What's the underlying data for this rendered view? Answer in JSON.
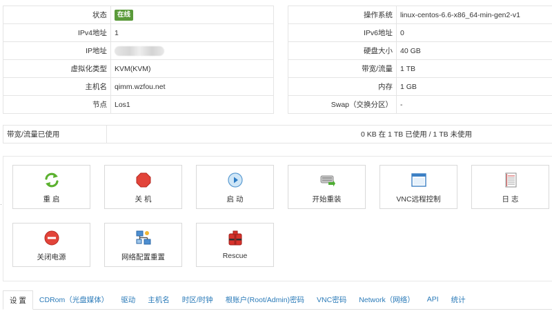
{
  "info_left": [
    {
      "key": "状态",
      "value": "在线",
      "type": "badge"
    },
    {
      "key": "IPv4地址",
      "value": "1"
    },
    {
      "key": "IP地址",
      "value": "",
      "type": "blur"
    },
    {
      "key": "虚拟化类型",
      "value": "KVM(KVM)"
    },
    {
      "key": "主机名",
      "value": "qimm.wzfou.net"
    },
    {
      "key": "节点",
      "value": "Los1"
    }
  ],
  "info_right": [
    {
      "key": "操作系统",
      "value": "linux-centos-6.6-x86_64-min-gen2-v1"
    },
    {
      "key": "IPv6地址",
      "value": "0"
    },
    {
      "key": "硬盘大小",
      "value": "40 GB"
    },
    {
      "key": "带宽/流量",
      "value": "1 TB"
    },
    {
      "key": "内存",
      "value": "1 GB"
    },
    {
      "key": "Swap（交换分区）",
      "value": "-"
    }
  ],
  "usage": {
    "label": "带宽/流量已使用",
    "value": "0 KB 在 1 TB 已使用 / 1 TB 未使用"
  },
  "actions": [
    {
      "label": "重 启",
      "icon": "refresh-icon"
    },
    {
      "label": "关 机",
      "icon": "stop-icon"
    },
    {
      "label": "启 动",
      "icon": "play-icon"
    },
    {
      "label": "开始重装",
      "icon": "reinstall-icon"
    },
    {
      "label": "VNC远程控制",
      "icon": "window-icon"
    },
    {
      "label": "日 志",
      "icon": "log-icon"
    },
    {
      "label": "关闭电源",
      "icon": "power-off-icon"
    },
    {
      "label": "网络配置重置",
      "icon": "network-icon"
    },
    {
      "label": "Rescue",
      "icon": "rescue-icon"
    }
  ],
  "tabs": [
    {
      "label": "设 置",
      "active": true
    },
    {
      "label": "CDRom（光盘媒体）"
    },
    {
      "label": "驱动"
    },
    {
      "label": "主机名"
    },
    {
      "label": "时区/时钟"
    },
    {
      "label": "根账户(Root/Admin)密码"
    },
    {
      "label": "VNC密码"
    },
    {
      "label": "Network（网络）"
    },
    {
      "label": "API"
    },
    {
      "label": "统计"
    }
  ],
  "colors": {
    "badge": "#5a9a3a",
    "link": "#2a7ab8",
    "border": "#e4e4e4"
  }
}
